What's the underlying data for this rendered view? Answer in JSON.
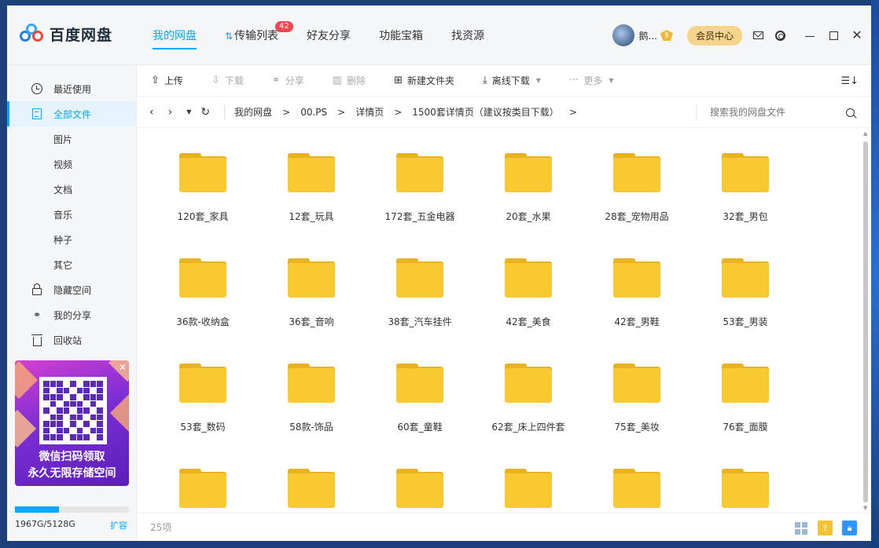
{
  "app": {
    "name": "百度网盘"
  },
  "nav": {
    "items": [
      {
        "label": "我的网盘"
      },
      {
        "label": "传输列表",
        "badge": "42"
      },
      {
        "label": "好友分享"
      },
      {
        "label": "功能宝箱"
      },
      {
        "label": "找资源"
      }
    ]
  },
  "user": {
    "name": "鹅...",
    "vip_icon": "$",
    "member_button": "会员中心"
  },
  "sidebar": {
    "items": [
      {
        "label": "最近使用"
      },
      {
        "label": "全部文件"
      },
      {
        "label": "图片"
      },
      {
        "label": "视频"
      },
      {
        "label": "文档"
      },
      {
        "label": "音乐"
      },
      {
        "label": "种子"
      },
      {
        "label": "其它"
      },
      {
        "label": "隐藏空间"
      },
      {
        "label": "我的分享"
      },
      {
        "label": "回收站"
      }
    ],
    "promo": {
      "line1": "微信扫码领取",
      "line2": "永久无限存储空间"
    },
    "storage": {
      "used_text": "1967G/5128G",
      "used_fraction": 0.384,
      "expand_label": "扩容"
    }
  },
  "toolbar": {
    "upload": "上传",
    "download": "下载",
    "share": "分享",
    "delete": "删除",
    "new_folder": "新建文件夹",
    "offline_download": "离线下载",
    "more": "更多"
  },
  "path": {
    "crumbs": [
      "我的网盘",
      "00.PS",
      "详情页",
      "1500套详情页（建议按类目下载）"
    ],
    "search_placeholder": "搜索我的网盘文件"
  },
  "folders": [
    "120套_家具",
    "12套_玩具",
    "172套_五金电器",
    "20套_水果",
    "28套_宠物用品",
    "32套_男包",
    "36款-收纳盒",
    "36套_音响",
    "38套_汽车挂件",
    "42套_美食",
    "42套_男鞋",
    "53套_男装",
    "53套_数码",
    "58款-饰品",
    "60套_童鞋",
    "62套_床上四件套",
    "75套_美妆",
    "76套_面膜",
    "",
    "",
    "",
    "",
    "",
    ""
  ],
  "status": {
    "item_count": "25项"
  },
  "colors": {
    "accent": "#06a7ff",
    "folder": "#f8c930",
    "badge": "#f0464d"
  }
}
